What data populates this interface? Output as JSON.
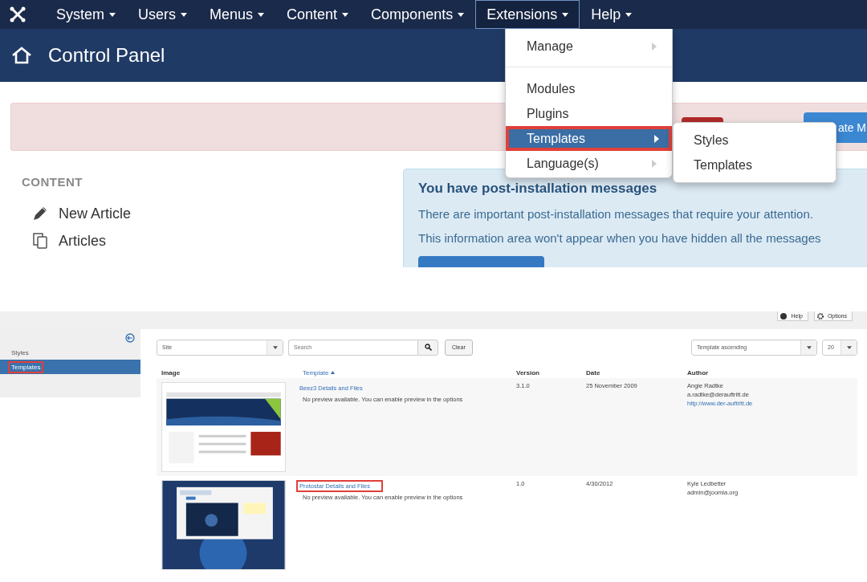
{
  "top_screenshot": {
    "navbar": {
      "items": [
        {
          "label": "System",
          "open": false
        },
        {
          "label": "Users",
          "open": false
        },
        {
          "label": "Menus",
          "open": false
        },
        {
          "label": "Content",
          "open": false
        },
        {
          "label": "Components",
          "open": false
        },
        {
          "label": "Extensions",
          "open": true
        },
        {
          "label": "Help",
          "open": false
        }
      ]
    },
    "header": {
      "title": "Control Panel"
    },
    "alert": {
      "button_text": "ate M"
    },
    "extensions_menu": {
      "items": [
        {
          "kind": "submenu",
          "label": "Manage",
          "selected": false,
          "highlighted": false
        },
        {
          "kind": "divider"
        },
        {
          "kind": "item",
          "label": "Modules",
          "selected": false,
          "highlighted": false
        },
        {
          "kind": "item",
          "label": "Plugins",
          "selected": false,
          "highlighted": false
        },
        {
          "kind": "submenu",
          "label": "Templates",
          "selected": true,
          "highlighted": true
        },
        {
          "kind": "submenu",
          "label": "Language(s)",
          "selected": false,
          "highlighted": false
        }
      ]
    },
    "templates_submenu": {
      "items": [
        {
          "label": "Styles"
        },
        {
          "label": "Templates"
        }
      ]
    },
    "content_section": {
      "heading": "CONTENT",
      "items": [
        {
          "kind": "pencil",
          "label": "New Article"
        },
        {
          "kind": "copy",
          "label": "Articles"
        }
      ]
    },
    "post_install": {
      "title": "You have post-installation messages",
      "paragraphs": [
        "There are important post-installation messages that require your attention.",
        "This information area won't appear when you have hidden all the messages"
      ]
    }
  },
  "bottom_screenshot": {
    "toolbar": {
      "buttons": [
        {
          "kind": "help",
          "label": "Help"
        },
        {
          "kind": "options",
          "label": "Options"
        }
      ]
    },
    "sidebar": {
      "items": [
        {
          "label": "Styles",
          "selected": false,
          "highlighted": false
        },
        {
          "label": "Templates",
          "selected": true,
          "highlighted": true
        }
      ]
    },
    "filters": {
      "client": "Site",
      "search_placeholder": "Search",
      "clear": "Clear",
      "ordering": "Template ascending",
      "limit": "20"
    },
    "table": {
      "columns": [
        {
          "label": "Image",
          "sorted": false
        },
        {
          "label": "Template",
          "sorted": true
        },
        {
          "label": "Version",
          "sorted": false
        },
        {
          "label": "Date",
          "sorted": false
        },
        {
          "label": "Author",
          "sorted": false
        }
      ],
      "rows": [
        {
          "name": "Beez3 Details and Files",
          "highlighted": false,
          "description": "No preview available. You can enable preview in the options",
          "version": "3.1.0",
          "date": "25 November 2009",
          "author": "Angie Radtke",
          "email": "a.radtke@derauftritt.de",
          "url": "http://www.der-auftritt.de"
        },
        {
          "name": "Protostar Details and Files",
          "highlighted": true,
          "description": "No preview available. You can enable preview in the options",
          "version": "1.0",
          "date": "4/30/2012",
          "author": "Kyle Ledbetter",
          "email": "admin@joomla.org"
        }
      ]
    }
  }
}
